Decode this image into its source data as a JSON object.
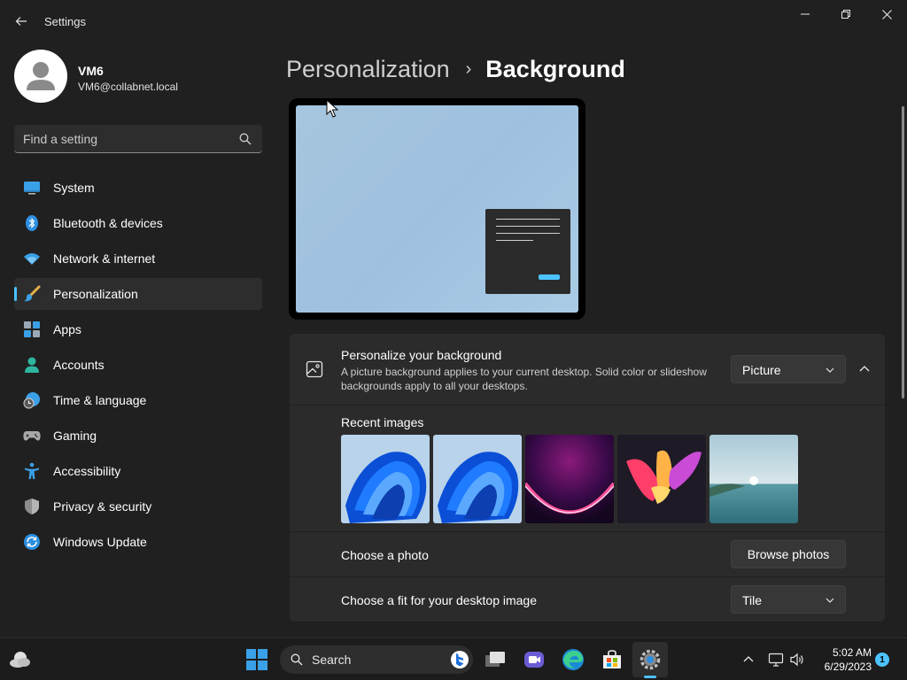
{
  "window": {
    "title": "Settings"
  },
  "profile": {
    "name": "VM6",
    "email": "VM6@collabnet.local"
  },
  "search": {
    "placeholder": "Find a setting"
  },
  "sidebar": {
    "items": [
      {
        "label": "System",
        "icon": "monitor-icon"
      },
      {
        "label": "Bluetooth & devices",
        "icon": "bluetooth-icon"
      },
      {
        "label": "Network & internet",
        "icon": "wifi-icon"
      },
      {
        "label": "Personalization",
        "icon": "brush-icon",
        "active": true
      },
      {
        "label": "Apps",
        "icon": "apps-icon"
      },
      {
        "label": "Accounts",
        "icon": "account-icon"
      },
      {
        "label": "Time & language",
        "icon": "clock-globe-icon"
      },
      {
        "label": "Gaming",
        "icon": "gamepad-icon"
      },
      {
        "label": "Accessibility",
        "icon": "accessibility-icon"
      },
      {
        "label": "Privacy & security",
        "icon": "shield-icon"
      },
      {
        "label": "Windows Update",
        "icon": "update-icon"
      }
    ]
  },
  "breadcrumb": {
    "parent": "Personalization",
    "separator": "›",
    "current": "Background"
  },
  "background": {
    "title": "Personalize your background",
    "description": "A picture background applies to your current desktop. Solid color or slideshow backgrounds apply to all your desktops.",
    "type_value": "Picture",
    "recent_title": "Recent images",
    "choose_photo_label": "Choose a photo",
    "browse_label": "Browse photos",
    "fit_label": "Choose a fit for your desktop image",
    "fit_value": "Tile"
  },
  "taskbar": {
    "search_label": "Search",
    "time": "5:02 AM",
    "date": "6/29/2023",
    "notifications": "1"
  },
  "colors": {
    "accent": "#4cc2ff",
    "background": "#202020",
    "card": "#2b2b2b"
  }
}
